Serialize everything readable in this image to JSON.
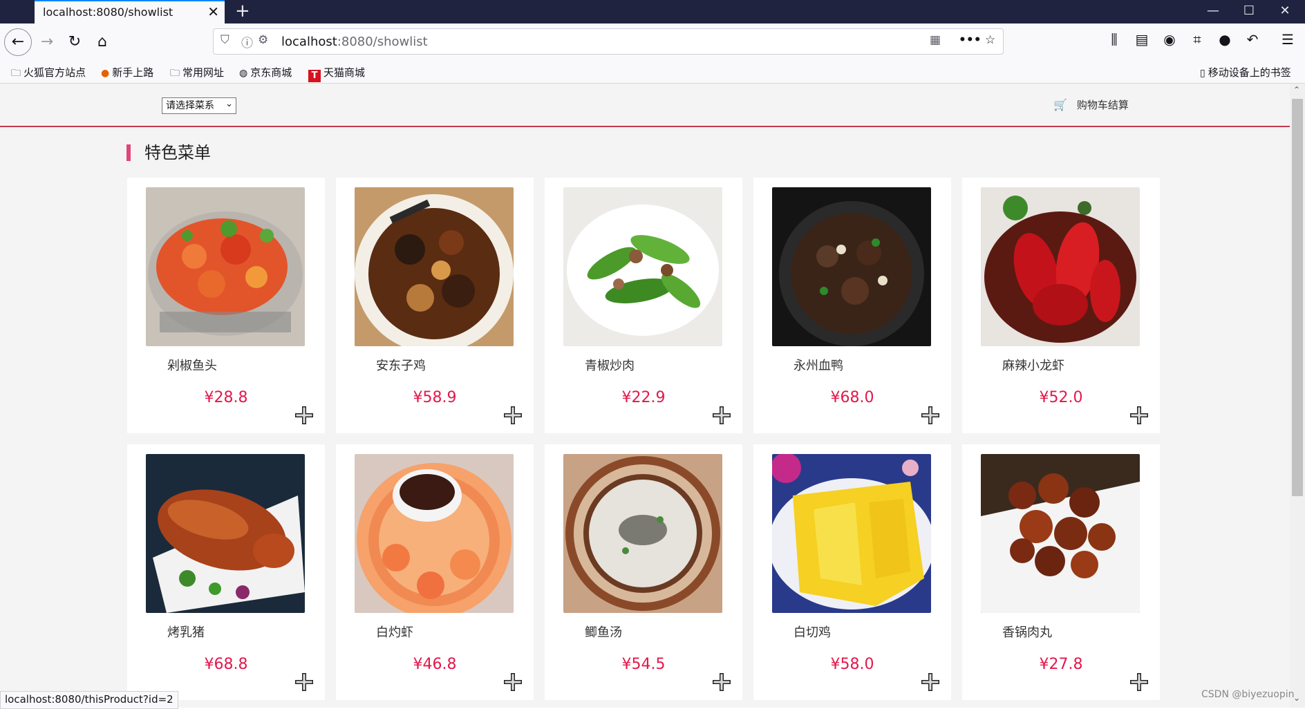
{
  "browser": {
    "tab_title": "localhost:8080/showlist",
    "url_host": "localhost",
    "url_rest": ":8080/showlist",
    "status_url": "localhost:8080/thisProduct?id=2",
    "bookmarks": [
      {
        "label": "火狐官方站点",
        "icon": "folder-icon"
      },
      {
        "label": "新手上路",
        "icon": "firefox-icon"
      },
      {
        "label": "常用网址",
        "icon": "folder-icon"
      },
      {
        "label": "京东商城",
        "icon": "globe-icon"
      },
      {
        "label": "天猫商城",
        "icon": "tmall-icon"
      }
    ],
    "mobile_bookmarks": "移动设备上的书签"
  },
  "page": {
    "category_select": "请选择菜系",
    "cart_link": "购物车结算",
    "section_title": "特色菜单",
    "accent_color": "#e4174a",
    "watermark": "CSDN @biyezuopin"
  },
  "dishes": [
    {
      "name": "剁椒鱼头",
      "price": "¥28.8"
    },
    {
      "name": "安东子鸡",
      "price": "¥58.9"
    },
    {
      "name": "青椒炒肉",
      "price": "¥22.9"
    },
    {
      "name": "永州血鸭",
      "price": "¥68.0"
    },
    {
      "name": "麻辣小龙虾",
      "price": "¥52.0"
    },
    {
      "name": "烤乳猪",
      "price": "¥68.8"
    },
    {
      "name": "白灼虾",
      "price": "¥46.8"
    },
    {
      "name": "鲫鱼汤",
      "price": "¥54.5"
    },
    {
      "name": "白切鸡",
      "price": "¥58.0"
    },
    {
      "name": "香锅肉丸",
      "price": "¥27.8"
    }
  ]
}
